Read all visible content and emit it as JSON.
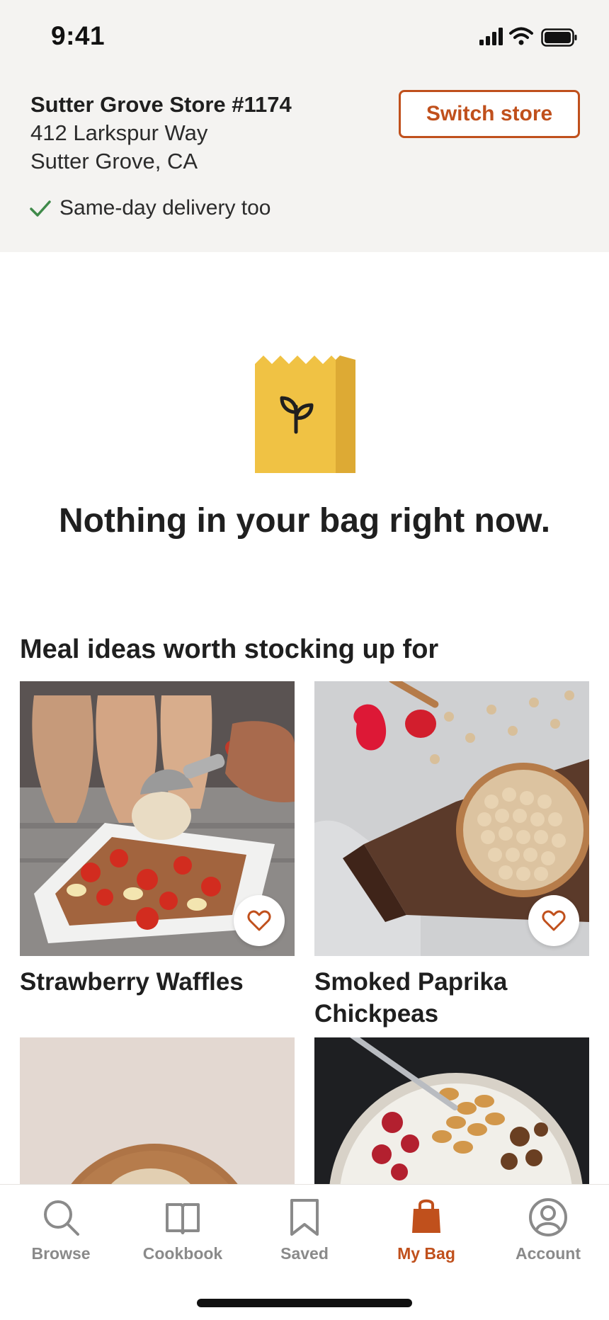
{
  "status_bar": {
    "time": "9:41"
  },
  "store": {
    "name": "Sutter Grove Store #1174",
    "address_line1": "412 Larkspur Way",
    "address_line2": "Sutter Grove, CA",
    "delivery_note": "Same-day delivery too",
    "switch_label": "Switch store"
  },
  "empty_state": {
    "title": "Nothing in your bag right now."
  },
  "meal_ideas": {
    "title": "Meal ideas worth stocking up for",
    "cards": [
      {
        "title": "Strawberry Waffles"
      },
      {
        "title": "Smoked Paprika Chickpeas"
      },
      {
        "title": ""
      },
      {
        "title": ""
      }
    ]
  },
  "tabbar": {
    "tabs": [
      {
        "label": "Browse",
        "icon": "search-icon"
      },
      {
        "label": "Cookbook",
        "icon": "book-icon"
      },
      {
        "label": "Saved",
        "icon": "bookmark-icon"
      },
      {
        "label": "My Bag",
        "icon": "bag-icon"
      },
      {
        "label": "Account",
        "icon": "account-icon"
      }
    ],
    "active": "My Bag"
  },
  "colors": {
    "accent": "#c0501c",
    "header_bg": "#f4f3f1",
    "check": "#3f8a4a",
    "bag": "#f0c244"
  }
}
